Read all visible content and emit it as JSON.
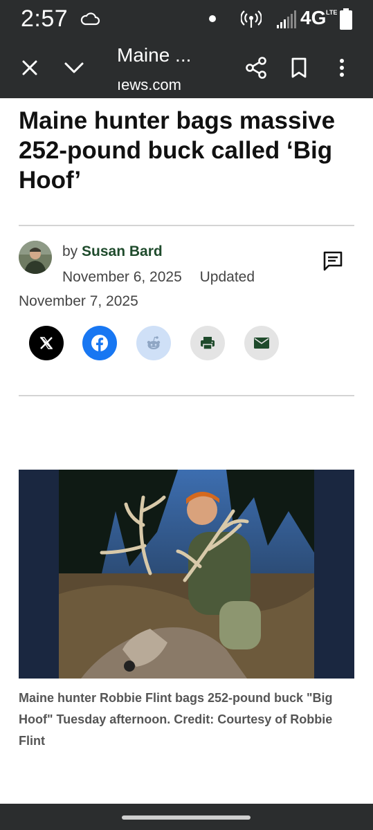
{
  "status_bar": {
    "time": "2:57",
    "network": "4G",
    "network_sub": "LTE",
    "icons": [
      "cloud-icon",
      "notification-dot-icon",
      "hotspot-icon",
      "signal-icon",
      "battery-icon"
    ]
  },
  "browser": {
    "page_title": "Maine ...",
    "url": "ıews.com",
    "icons": [
      "close-icon",
      "chevron-down-icon",
      "share-icon",
      "bookmark-icon",
      "more-vert-icon"
    ]
  },
  "article": {
    "headline": "Maine hunter bags massive 252-pound buck called ‘Big Hoof’",
    "byline_prefix": "by",
    "author": "Susan Bard",
    "published": "November 6, 2025",
    "updated_label": "Updated",
    "updated_date": "November 7, 2025",
    "share_buttons": [
      "x-icon",
      "facebook-icon",
      "reddit-icon",
      "print-icon",
      "email-icon"
    ],
    "caption": "Maine hunter Robbie Flint bags 252-pound buck \"Big Hoof\" Tuesday afternoon. Credit: Courtesy of Robbie Flint"
  },
  "colors": {
    "chrome": "#2b2d2e",
    "author_link": "#1f4b2c",
    "facebook": "#1877f2",
    "reddit_bg": "#cfe0f7",
    "x_bg": "#000000",
    "neutral_btn": "#e4e4e4"
  }
}
